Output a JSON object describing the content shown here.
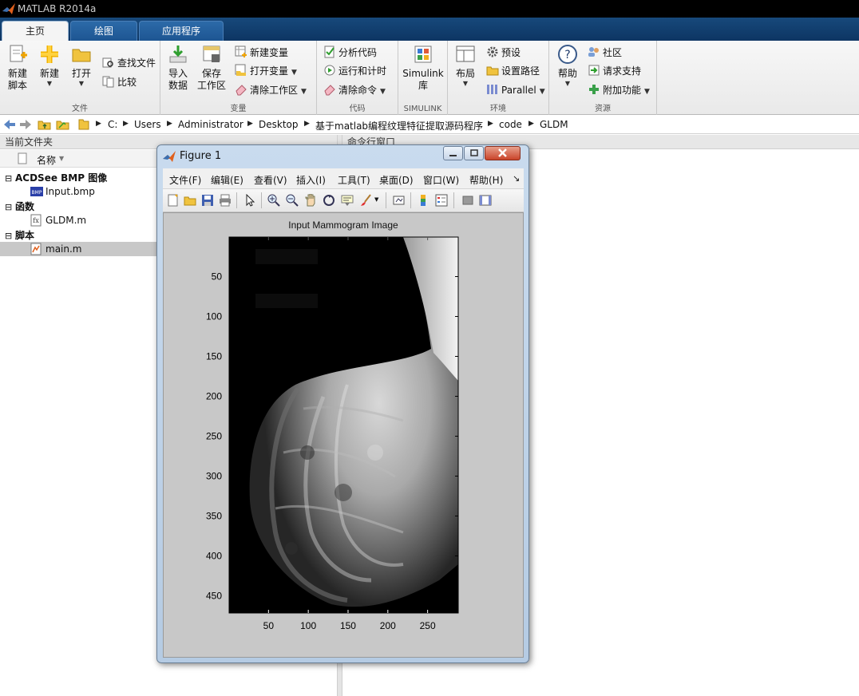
{
  "window": {
    "title": "MATLAB R2014a"
  },
  "tabs": [
    {
      "label": "主页",
      "active": true
    },
    {
      "label": "绘图",
      "active": false
    },
    {
      "label": "应用程序",
      "active": false
    }
  ],
  "ribbon": {
    "file": {
      "label": "文件",
      "new_script": [
        "新建",
        "脚本"
      ],
      "new": "新建",
      "open": "打开",
      "find_files": "查找文件",
      "compare": "比较"
    },
    "variable": {
      "label": "变量",
      "import": [
        "导入",
        "数据"
      ],
      "save_ws": [
        "保存",
        "工作区"
      ],
      "new_var": "新建变量",
      "open_var": "打开变量",
      "clear_ws": "清除工作区"
    },
    "code": {
      "label": "代码",
      "analyze": "分析代码",
      "run_time": "运行和计时",
      "clear_cmds": "清除命令"
    },
    "simulink": {
      "label": "SIMULINK",
      "lib": [
        "Simulink",
        "库"
      ]
    },
    "environment": {
      "label": "环境",
      "layout": "布局",
      "prefs": "预设",
      "set_path": "设置路径",
      "parallel": "Parallel"
    },
    "resources": {
      "label": "资源",
      "help": "帮助",
      "community": "社区",
      "support": "请求支持",
      "addons": "附加功能"
    }
  },
  "address": {
    "crumbs": [
      "C:",
      "Users",
      "Administrator",
      "Desktop",
      "基于matlab编程纹理特征提取源码程序",
      "code",
      "GLDM"
    ]
  },
  "left_panel": {
    "title": "当前文件夹",
    "col_name": "名称",
    "groups": [
      {
        "label": "ACDSee BMP 图像",
        "items": [
          "Input.bmp"
        ]
      },
      {
        "label": "函数",
        "items": [
          "GLDM.m"
        ]
      },
      {
        "label": "脚本",
        "items": [
          "main.m"
        ]
      }
    ]
  },
  "right_panel": {
    "title": "命令行窗口"
  },
  "figure": {
    "title": "Figure 1",
    "menus": [
      "文件(F)",
      "编辑(E)",
      "查看(V)",
      "插入(I)",
      "工具(T)",
      "桌面(D)",
      "窗口(W)",
      "帮助(H)"
    ],
    "axes": {
      "title": "Input Mammogram Image",
      "xticks": [
        "50",
        "100",
        "150",
        "200",
        "250"
      ],
      "yticks": [
        "50",
        "100",
        "150",
        "200",
        "250",
        "300",
        "350",
        "400",
        "450"
      ]
    }
  },
  "colors": {
    "titlebar": "#000000",
    "tabstrip": "#17497b",
    "ribbon": "#f0f0f0",
    "figure_bg": "#c8c8c8"
  }
}
